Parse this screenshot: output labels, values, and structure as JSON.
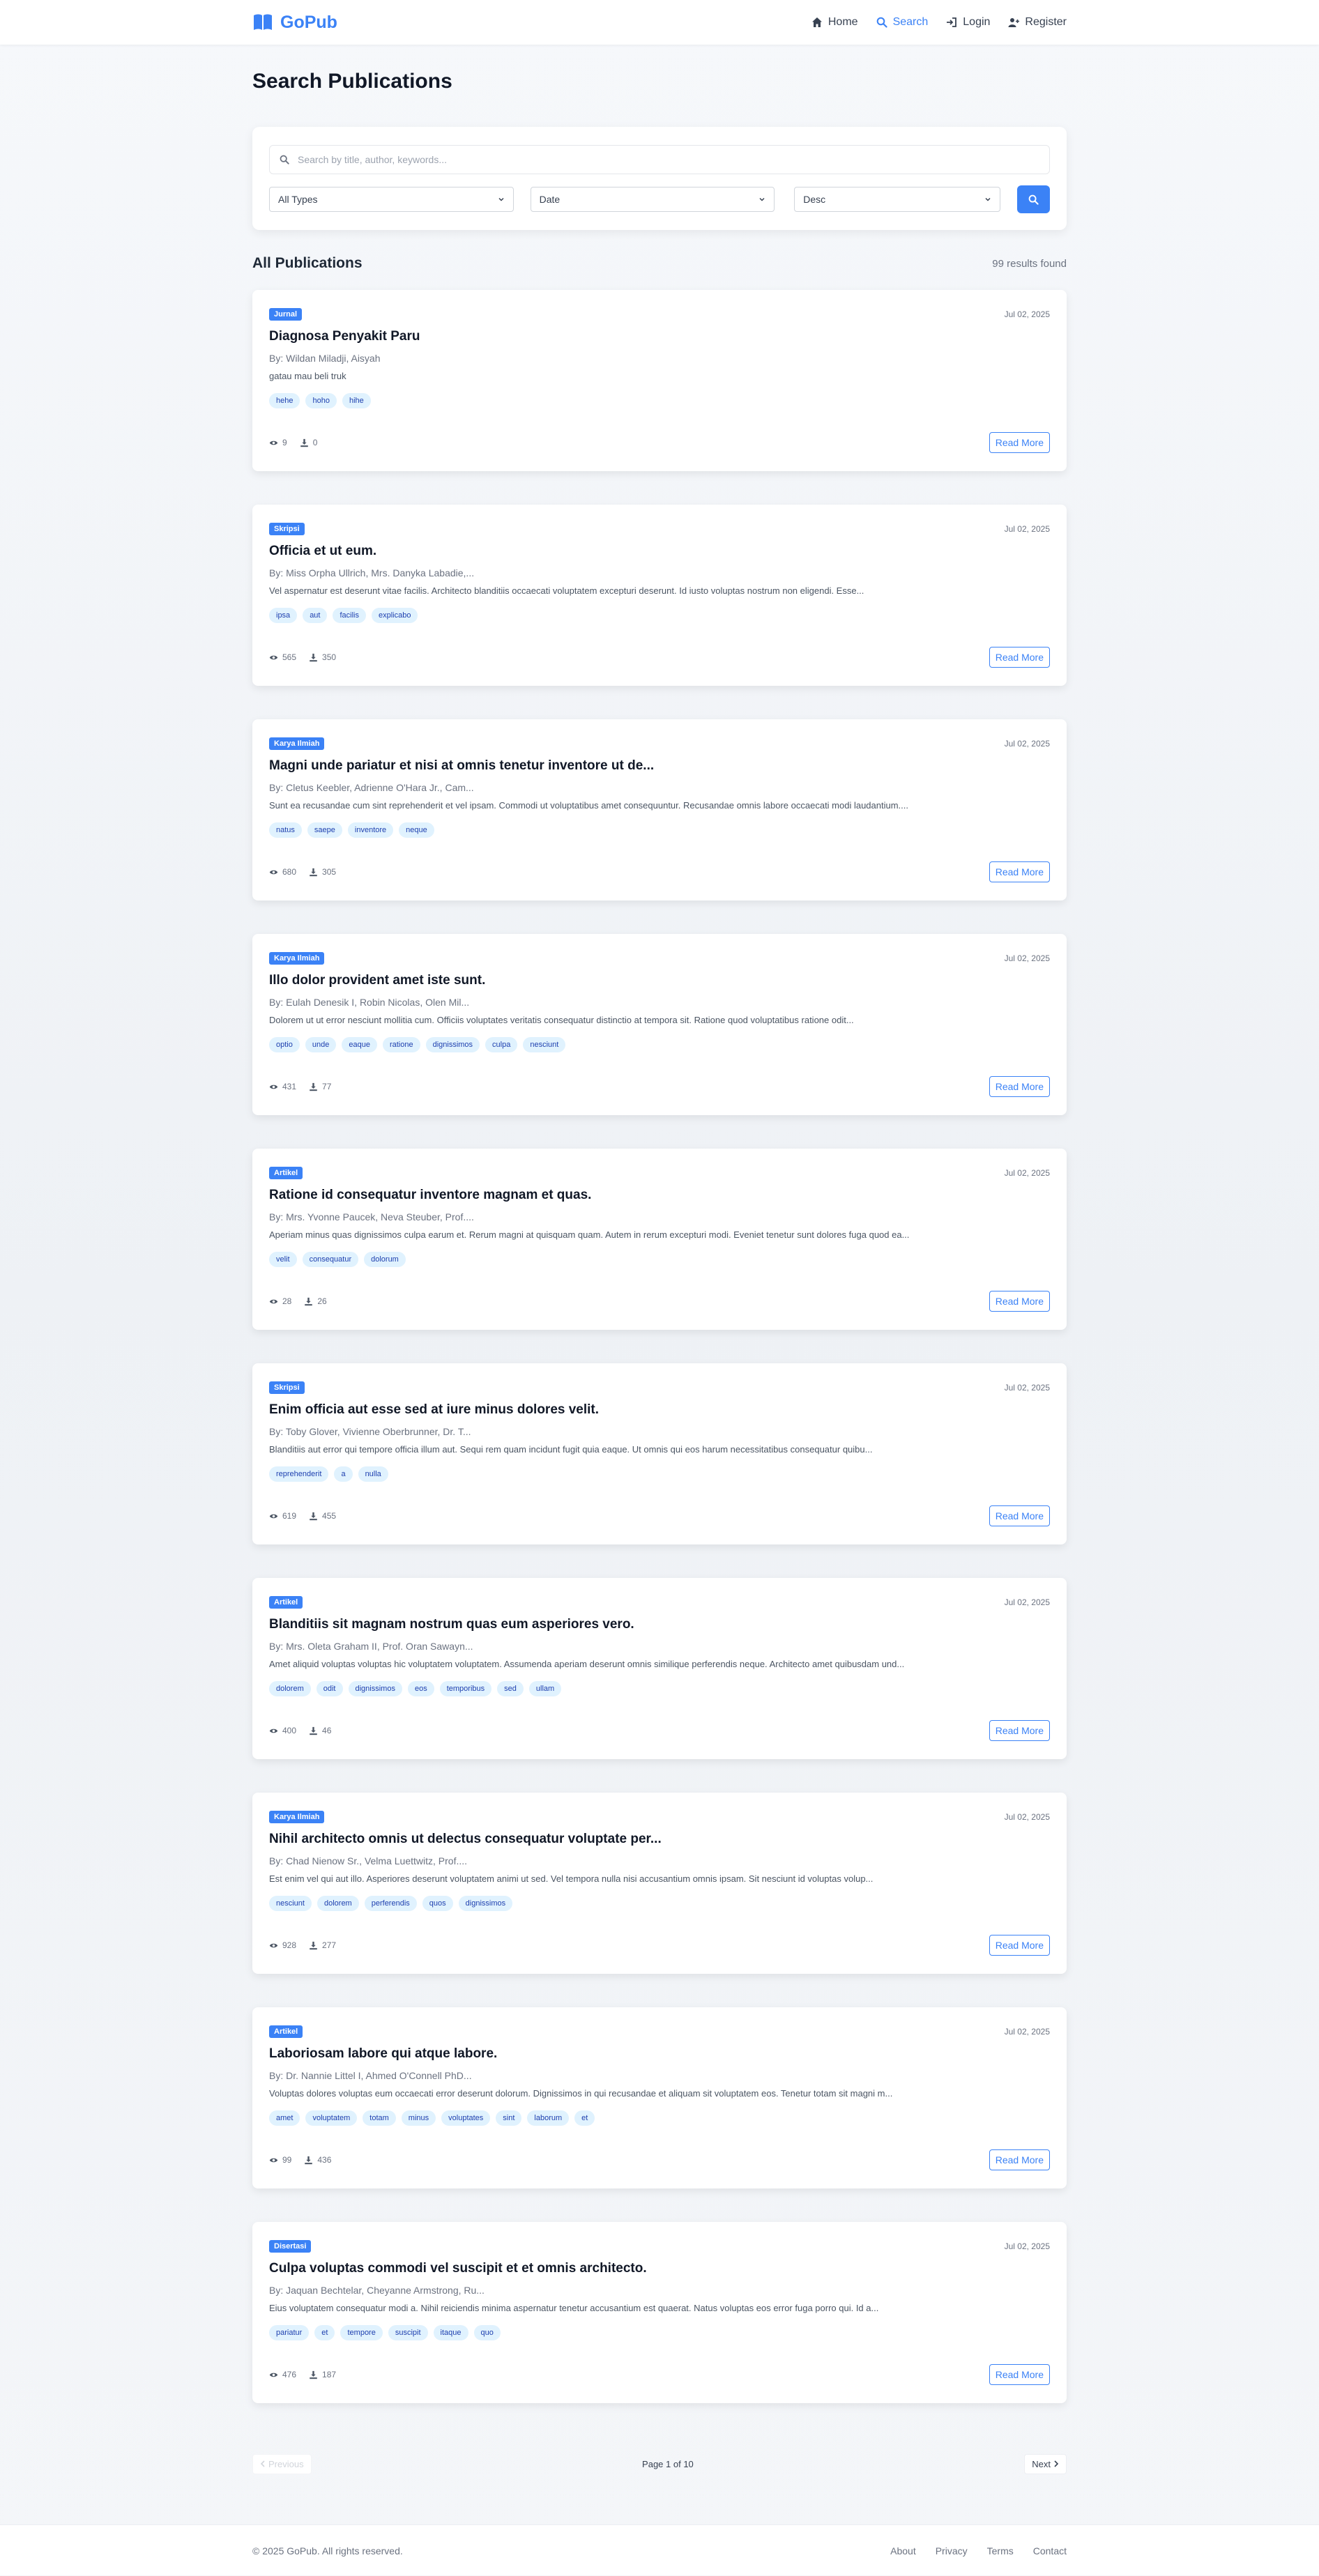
{
  "brand": {
    "name": "GoPub"
  },
  "nav": {
    "home": "Home",
    "search": "Search",
    "login": "Login",
    "register": "Register"
  },
  "page": {
    "title": "Search Publications"
  },
  "search": {
    "placeholder": "Search by title, author, keywords...",
    "type_value": "All Types",
    "date_value": "Date",
    "order_value": "Desc"
  },
  "results": {
    "title": "All Publications",
    "count": "99 results found"
  },
  "publications": [
    {
      "type": "Jurnal",
      "date": "Jul 02, 2025",
      "title": "Diagnosa Penyakit Paru",
      "authors": "By: Wildan Miladji, Aisyah",
      "abstract": "gatau mau beli truk",
      "tags": [
        "hehe",
        "hoho",
        "hihe"
      ],
      "views": "9",
      "downloads": "0",
      "read_more": "Read More"
    },
    {
      "type": "Skripsi",
      "date": "Jul 02, 2025",
      "title": "Officia et ut eum.",
      "authors": "By: Miss Orpha Ullrich, Mrs. Danyka Labadie,...",
      "abstract": "Vel aspernatur est deserunt vitae facilis. Architecto blanditiis occaecati voluptatem excepturi deserunt. Id iusto voluptas nostrum non eligendi. Esse...",
      "tags": [
        "ipsa",
        "aut",
        "facilis",
        "explicabo"
      ],
      "views": "565",
      "downloads": "350",
      "read_more": "Read More"
    },
    {
      "type": "Karya Ilmiah",
      "date": "Jul 02, 2025",
      "title": "Magni unde pariatur et nisi at omnis tenetur inventore ut de...",
      "authors": "By: Cletus Keebler, Adrienne O'Hara Jr., Cam...",
      "abstract": "Sunt ea recusandae cum sint reprehenderit et vel ipsam. Commodi ut voluptatibus amet consequuntur. Recusandae omnis labore occaecati modi laudantium....",
      "tags": [
        "natus",
        "saepe",
        "inventore",
        "neque"
      ],
      "views": "680",
      "downloads": "305",
      "read_more": "Read More"
    },
    {
      "type": "Karya Ilmiah",
      "date": "Jul 02, 2025",
      "title": "Illo dolor provident amet iste sunt.",
      "authors": "By: Eulah Denesik I, Robin Nicolas, Olen Mil...",
      "abstract": "Dolorem ut ut error nesciunt mollitia cum. Officiis voluptates veritatis consequatur distinctio at tempora sit. Ratione quod voluptatibus ratione odit...",
      "tags": [
        "optio",
        "unde",
        "eaque",
        "ratione",
        "dignissimos",
        "culpa",
        "nesciunt"
      ],
      "views": "431",
      "downloads": "77",
      "read_more": "Read More"
    },
    {
      "type": "Artikel",
      "date": "Jul 02, 2025",
      "title": "Ratione id consequatur inventore magnam et quas.",
      "authors": "By: Mrs. Yvonne Paucek, Neva Steuber, Prof....",
      "abstract": "Aperiam minus quas dignissimos culpa earum et. Rerum magni at quisquam quam. Autem in rerum excepturi modi. Eveniet tenetur sunt dolores fuga quod ea...",
      "tags": [
        "velit",
        "consequatur",
        "dolorum"
      ],
      "views": "28",
      "downloads": "26",
      "read_more": "Read More"
    },
    {
      "type": "Skripsi",
      "date": "Jul 02, 2025",
      "title": "Enim officia aut esse sed at iure minus dolores velit.",
      "authors": "By: Toby Glover, Vivienne Oberbrunner, Dr. T...",
      "abstract": "Blanditiis aut error qui tempore officia illum aut. Sequi rem quam incidunt fugit quia eaque. Ut omnis qui eos harum necessitatibus consequatur quibu...",
      "tags": [
        "reprehenderit",
        "a",
        "nulla"
      ],
      "views": "619",
      "downloads": "455",
      "read_more": "Read More"
    },
    {
      "type": "Artikel",
      "date": "Jul 02, 2025",
      "title": "Blanditiis sit magnam nostrum quas eum asperiores vero.",
      "authors": "By: Mrs. Oleta Graham II, Prof. Oran Sawayn...",
      "abstract": "Amet aliquid voluptas voluptas hic voluptatem voluptatem. Assumenda aperiam deserunt omnis similique perferendis neque. Architecto amet quibusdam und...",
      "tags": [
        "dolorem",
        "odit",
        "dignissimos",
        "eos",
        "temporibus",
        "sed",
        "ullam"
      ],
      "views": "400",
      "downloads": "46",
      "read_more": "Read More"
    },
    {
      "type": "Karya Ilmiah",
      "date": "Jul 02, 2025",
      "title": "Nihil architecto omnis ut delectus consequatur voluptate per...",
      "authors": "By: Chad Nienow Sr., Velma Luettwitz, Prof....",
      "abstract": "Est enim vel qui aut illo. Asperiores deserunt voluptatem animi ut sed. Vel tempora nulla nisi accusantium omnis ipsam. Sit nesciunt id voluptas volup...",
      "tags": [
        "nesciunt",
        "dolorem",
        "perferendis",
        "quos",
        "dignissimos"
      ],
      "views": "928",
      "downloads": "277",
      "read_more": "Read More"
    },
    {
      "type": "Artikel",
      "date": "Jul 02, 2025",
      "title": "Laboriosam labore qui atque labore.",
      "authors": "By: Dr. Nannie Littel I, Ahmed O'Connell PhD...",
      "abstract": "Voluptas dolores voluptas eum occaecati error deserunt dolorum. Dignissimos in qui recusandae et aliquam sit voluptatem eos. Tenetur totam sit magni m...",
      "tags": [
        "amet",
        "voluptatem",
        "totam",
        "minus",
        "voluptates",
        "sint",
        "laborum",
        "et"
      ],
      "views": "99",
      "downloads": "436",
      "read_more": "Read More"
    },
    {
      "type": "Disertasi",
      "date": "Jul 02, 2025",
      "title": "Culpa voluptas commodi vel suscipit et et omnis architecto.",
      "authors": "By: Jaquan Bechtelar, Cheyanne Armstrong, Ru...",
      "abstract": "Eius voluptatem consequatur modi a. Nihil reiciendis minima aspernatur tenetur accusantium est quaerat. Natus voluptas eos error fuga porro qui. Id a...",
      "tags": [
        "pariatur",
        "et",
        "tempore",
        "suscipit",
        "itaque",
        "quo"
      ],
      "views": "476",
      "downloads": "187",
      "read_more": "Read More"
    }
  ],
  "pagination": {
    "previous": "Previous",
    "info": "Page 1 of 10",
    "next": "Next"
  },
  "footer": {
    "copyright": "© 2025 GoPub. All rights reserved.",
    "links": [
      "About",
      "Privacy",
      "Terms",
      "Contact"
    ]
  },
  "colors": {
    "accent": "#3b82f6",
    "tag_bg": "#e0f2fe",
    "tag_text": "#1e40af"
  }
}
